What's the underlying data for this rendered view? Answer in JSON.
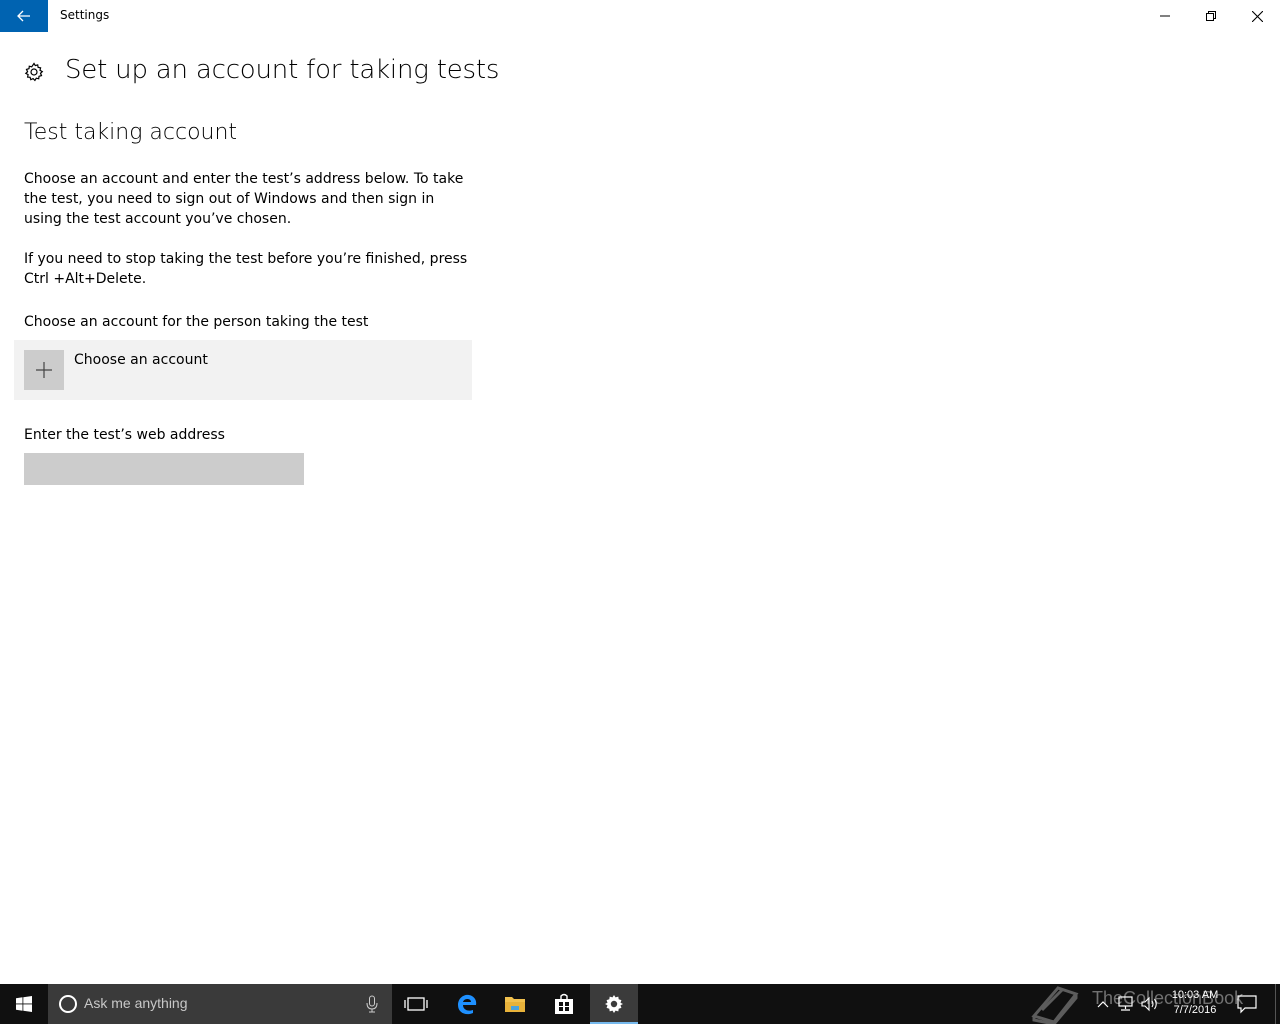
{
  "window": {
    "title": "Settings"
  },
  "page": {
    "title": "Set up an account for taking tests",
    "section_heading": "Test taking account",
    "paragraph1": "Choose an account and enter the test’s address below. To take the test, you need to sign out of Windows and then sign in using the test account you’ve chosen.",
    "paragraph2": "If you need to stop taking the test before you’re finished, press Ctrl +Alt+Delete.",
    "account_label": "Choose an account for the person taking the test",
    "choose_account_label": "Choose an account",
    "web_address_label": "Enter the test’s web address",
    "web_address_value": ""
  },
  "taskbar": {
    "search_placeholder": "Ask me anything",
    "time": "10:03 AM",
    "date": "7/7/2016",
    "watermark": "TheCollectionBook"
  },
  "colors": {
    "accent": "#0063b1",
    "taskbar": "#101010",
    "search_box": "#3a3a3a",
    "tile_bg": "#f2f2f2",
    "input_bg": "#cccccc"
  },
  "icons": [
    "back-arrow-icon",
    "minimize-icon",
    "maximize-icon",
    "close-icon",
    "gear-icon",
    "plus-icon",
    "windows-logo-icon",
    "cortana-icon",
    "microphone-icon",
    "task-view-icon",
    "edge-icon",
    "file-explorer-icon",
    "store-icon",
    "settings-gear-icon",
    "chevron-up-icon",
    "network-icon",
    "volume-icon",
    "action-center-icon"
  ]
}
